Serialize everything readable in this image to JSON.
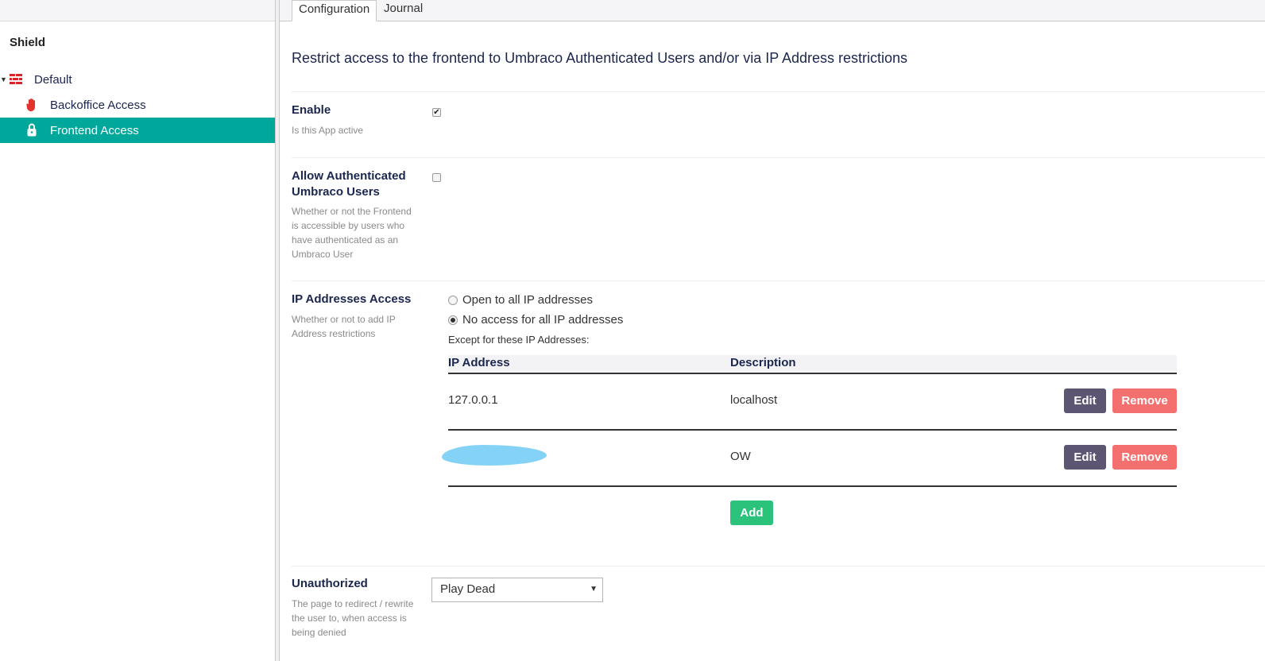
{
  "sidebar": {
    "title": "Shield",
    "tree": [
      {
        "label": "Default",
        "icon": "brick-wall-icon",
        "expanded": true
      },
      {
        "label": "Backoffice Access",
        "icon": "hand-stop-icon"
      },
      {
        "label": "Frontend Access",
        "icon": "padlock-icon",
        "active": true
      }
    ]
  },
  "tabs": [
    {
      "label": "Configuration",
      "active": true
    },
    {
      "label": "Journal"
    }
  ],
  "main": {
    "heading": "Restrict access to the frontend to Umbraco Authenticated Users and/or via IP Address restrictions",
    "enable": {
      "label": "Enable",
      "description": "Is this App active",
      "checked": true
    },
    "allow_auth": {
      "label_line1": "Allow Authenticated",
      "label_line2": "Umbraco Users",
      "description": "Whether or not the Frontend is accessible by users who have authenticated as an Umbraco User",
      "checked": false
    },
    "ip_access": {
      "label": "IP Addresses Access",
      "description": "Whether or not to add IP Address restrictions",
      "options": [
        {
          "label": "Open to all IP addresses",
          "selected": false
        },
        {
          "label": "No access for all IP addresses",
          "selected": true
        }
      ],
      "except_label": "Except for these IP Addresses:",
      "table": {
        "headers": [
          "IP Address",
          "Description"
        ],
        "rows": [
          {
            "ip": "127.0.0.1",
            "description": "localhost",
            "redacted": false
          },
          {
            "ip": "",
            "description": "OW",
            "redacted": true
          }
        ],
        "edit_label": "Edit",
        "remove_label": "Remove",
        "add_label": "Add"
      }
    },
    "unauthorized": {
      "label": "Unauthorized",
      "description": "The page to redirect / rewrite the user to, when access is being denied",
      "selected": "Play Dead"
    }
  },
  "colors": {
    "active_tree": "#00a89c",
    "edit_button": "#5d5672",
    "remove_button": "#f4706e",
    "add_button": "#2bc37c",
    "redaction": "#84d3f6"
  }
}
